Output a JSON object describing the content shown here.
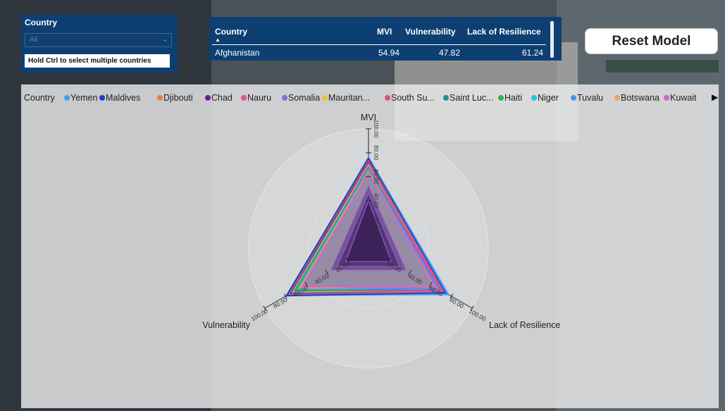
{
  "slicer": {
    "title": "Country",
    "value": "All",
    "hint": "Hold Ctrl to select multiple countries"
  },
  "table": {
    "headers": [
      "Country",
      "MVI",
      "Vulnerability",
      "Lack of Resilience"
    ],
    "rows": [
      [
        "Afghanistan",
        "54.94",
        "47.82",
        "61.24"
      ]
    ]
  },
  "reset_button": "Reset Model",
  "legend": {
    "title": "Country",
    "items": [
      {
        "label": "Yemen",
        "color": "#3aa0ff"
      },
      {
        "label": "Maldives",
        "color": "#1d3fbf"
      },
      {
        "label": "Djibouti",
        "color": "#f07b3f"
      },
      {
        "label": "Chad",
        "color": "#6b1f8a"
      },
      {
        "label": "Nauru",
        "color": "#e54f9e"
      },
      {
        "label": "Somalia",
        "color": "#8a6fd1"
      },
      {
        "label": "Mauritan...",
        "color": "#e8c33a"
      },
      {
        "label": "South Su...",
        "color": "#e0506a"
      },
      {
        "label": "Saint Luc...",
        "color": "#1f8f8a"
      },
      {
        "label": "Haiti",
        "color": "#2db14f"
      },
      {
        "label": "Niger",
        "color": "#23c6e8"
      },
      {
        "label": "Tuvalu",
        "color": "#4b8ff0"
      },
      {
        "label": "Botswana",
        "color": "#f2a25a"
      },
      {
        "label": "Kuwait",
        "color": "#cc66cc"
      }
    ]
  },
  "chart_data": {
    "type": "radar",
    "axes": [
      "MVI",
      "Vulnerability",
      "Lack of Resilience"
    ],
    "range": [
      0,
      100
    ],
    "ticks": [
      "20.00",
      "40.00",
      "60.00",
      "80.00",
      "100.00"
    ],
    "series": [
      {
        "name": "Yemen",
        "values": [
          76,
          78,
          77
        ]
      },
      {
        "name": "Maldives",
        "values": [
          75,
          79,
          74
        ]
      },
      {
        "name": "Djibouti",
        "values": [
          73,
          76,
          72
        ]
      },
      {
        "name": "Chad",
        "values": [
          72,
          75,
          71
        ]
      },
      {
        "name": "Nauru",
        "values": [
          71,
          73,
          72
        ]
      },
      {
        "name": "Somalia",
        "values": [
          70,
          74,
          70
        ]
      },
      {
        "name": "Mauritan...",
        "values": [
          69,
          72,
          69
        ]
      },
      {
        "name": "South Su...",
        "values": [
          68,
          70,
          70
        ]
      },
      {
        "name": "Saint Luc...",
        "values": [
          67,
          71,
          67
        ]
      },
      {
        "name": "Haiti",
        "values": [
          66,
          70,
          66
        ]
      },
      {
        "name": "Niger",
        "values": [
          66,
          68,
          67
        ]
      },
      {
        "name": "Tuvalu",
        "values": [
          65,
          67,
          68
        ]
      },
      {
        "name": "Botswana",
        "values": [
          64,
          66,
          64
        ]
      },
      {
        "name": "Kuwait",
        "values": [
          63,
          64,
          65
        ]
      }
    ]
  }
}
